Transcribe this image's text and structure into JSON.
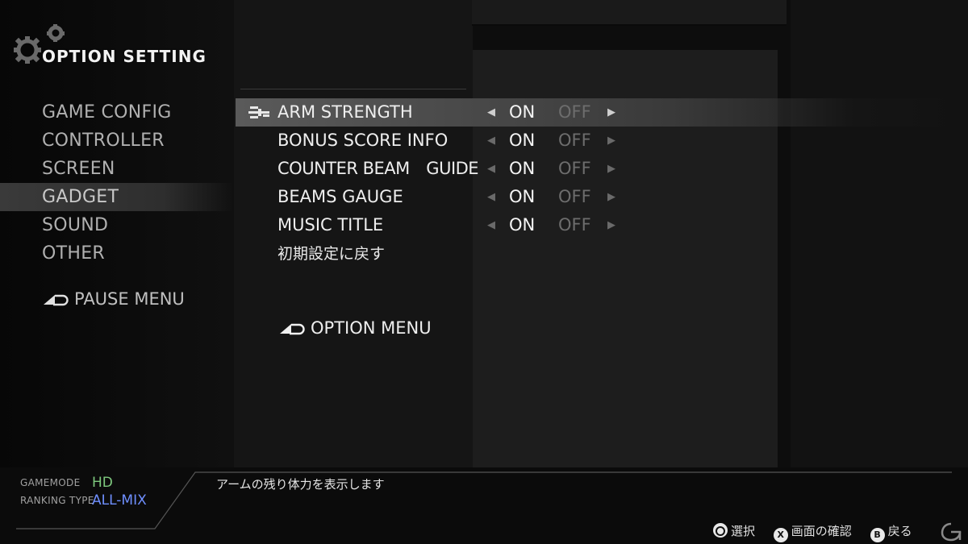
{
  "header": {
    "title": "OPTION SETTING",
    "icon": "gear-icon"
  },
  "side_menu": {
    "items": [
      {
        "label": "GAME CONFIG",
        "selected": false
      },
      {
        "label": "CONTROLLER",
        "selected": false
      },
      {
        "label": "SCREEN",
        "selected": false
      },
      {
        "label": "GADGET",
        "selected": true
      },
      {
        "label": "SOUND",
        "selected": false
      },
      {
        "label": "OTHER",
        "selected": false
      }
    ],
    "pause_menu_label": "PAUSE MENU"
  },
  "options": {
    "rows": [
      {
        "label": "ARM STRENGTH",
        "on": "ON",
        "off": "OFF",
        "value": "ON",
        "selected": true
      },
      {
        "label": "BONUS SCORE INFO",
        "on": "ON",
        "off": "OFF",
        "value": "ON",
        "selected": false
      },
      {
        "label": "COUNTER BEAM　GUIDE",
        "on": "ON",
        "off": "OFF",
        "value": "ON",
        "selected": false
      },
      {
        "label": "BEAMS GAUGE",
        "on": "ON",
        "off": "OFF",
        "value": "ON",
        "selected": false
      },
      {
        "label": "MUSIC TITLE",
        "on": "ON",
        "off": "OFF",
        "value": "ON",
        "selected": false
      }
    ],
    "reset_label": "初期設定に戻す",
    "option_menu_label": "OPTION MENU"
  },
  "footer": {
    "gamemode_label": "GAMEMODE",
    "gamemode_value": "HD",
    "ranking_label": "RANKING TYPE",
    "ranking_value": "ALL-MIX",
    "description": "アームの残り体力を表示します",
    "hints": [
      {
        "button": "circle-button-icon",
        "glyph": "",
        "label": "選択"
      },
      {
        "button": "x-button-icon",
        "glyph": "X",
        "label": "画面の確認"
      },
      {
        "button": "b-button-icon",
        "glyph": "B",
        "label": "戻る"
      }
    ]
  },
  "colors": {
    "gamemode_value": "#7ec97e",
    "ranking_value": "#6f8fff",
    "off_inactive": "#6d6d6d"
  }
}
